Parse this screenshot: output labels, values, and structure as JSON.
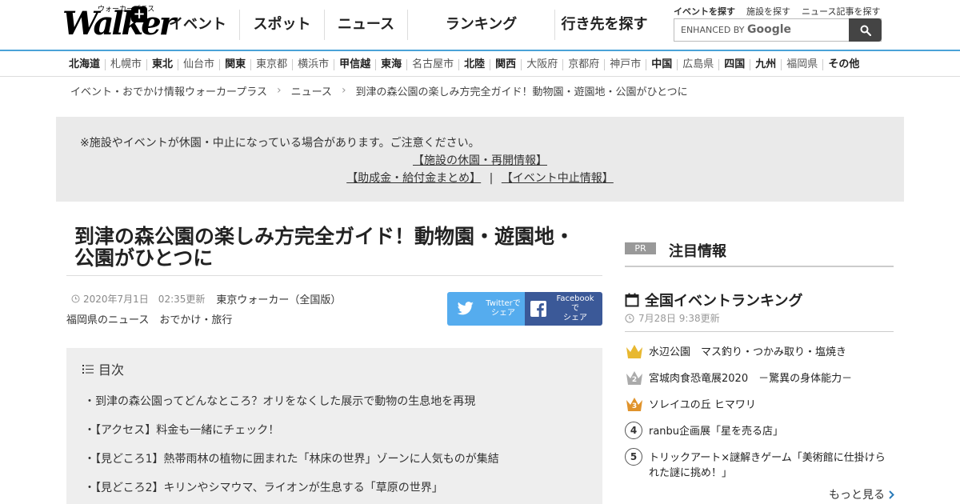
{
  "header": {
    "logo": {
      "name": "Walker",
      "sub": "ウォーカープラス",
      "plus": "+"
    },
    "nav": [
      "イベント",
      "スポット",
      "ニュース",
      "ランキング",
      "行き先を探す"
    ],
    "subnav": [
      "イベントを探す",
      "施設を探す",
      "ニュース記事を探す"
    ],
    "search": {
      "prefix": "ENHANCED BY",
      "brand": "Google"
    }
  },
  "regions": [
    {
      "label": "北海道",
      "major": true
    },
    {
      "label": "札幌市",
      "major": false
    },
    {
      "label": "東北",
      "major": true
    },
    {
      "label": "仙台市",
      "major": false
    },
    {
      "label": "関東",
      "major": true
    },
    {
      "label": "東京都",
      "major": false
    },
    {
      "label": "横浜市",
      "major": false
    },
    {
      "label": "甲信越",
      "major": true
    },
    {
      "label": "東海",
      "major": true
    },
    {
      "label": "名古屋市",
      "major": false
    },
    {
      "label": "北陸",
      "major": true
    },
    {
      "label": "関西",
      "major": true
    },
    {
      "label": "大阪府",
      "major": false
    },
    {
      "label": "京都府",
      "major": false
    },
    {
      "label": "神戸市",
      "major": false
    },
    {
      "label": "中国",
      "major": true
    },
    {
      "label": "広島県",
      "major": false
    },
    {
      "label": "四国",
      "major": true
    },
    {
      "label": "九州",
      "major": true
    },
    {
      "label": "福岡県",
      "major": false
    },
    {
      "label": "その他",
      "major": true
    }
  ],
  "breadcrumb": [
    "イベント・おでかけ情報ウォーカープラス",
    "ニュース",
    "到津の森公園の楽しみ方完全ガイド！動物園・遊園地・公園がひとつに"
  ],
  "notice": {
    "text": "※施設やイベントが休園・中止になっている場合があります。ご注意ください。",
    "link1": "【施設の休園・再開情報】",
    "link2": "【助成金・給付金まとめ】",
    "separator": "|",
    "link3": "【イベント中止情報】"
  },
  "article": {
    "title": "到津の森公園の楽しみ方完全ガイド！動物園・遊園地・公園がひとつに",
    "date": "2020年7月1日　02:35更新",
    "publisher": "東京ウォーカー（全国版）",
    "categories": "福岡県のニュース　おでかけ・旅行",
    "share": {
      "twitter": [
        "Twitterで",
        "シェア"
      ],
      "facebook": [
        "Facebookで",
        "シェア"
      ]
    }
  },
  "toc": {
    "title": "目次",
    "items": [
      "・到津の森公園ってどんなところ？オリをなくした展示で動物の生息地を再現",
      "・【アクセス】料金も一緒にチェック！",
      "・【見どころ1】熱帯雨林の植物に囲まれた「林床の世界」ゾーンに人気ものが集結",
      "・【見どころ2】キリンやシマウマ、ライオンが生息する「草原の世界」"
    ]
  },
  "sidebar": {
    "pr_badge": "PR",
    "pr_title": "注目情報",
    "ranking_title": "全国イベントランキング",
    "ranking_updated": "7月28日 9:38更新",
    "ranking": [
      {
        "rank": "1",
        "title": "水辺公園　マス釣り・つかみ取り・塩焼き",
        "crown_color": "#e8b830"
      },
      {
        "rank": "2",
        "title": "宮城肉食恐竜展2020　－驚異の身体能力－",
        "crown_color": "#aaaaaa"
      },
      {
        "rank": "3",
        "title": "ソレイユの丘 ヒマワリ",
        "crown_color": "#e0932c"
      },
      {
        "rank": "4",
        "title": "ranbu企画展「星を売る店」",
        "crown_color": ""
      },
      {
        "rank": "5",
        "title": "トリックアート×謎解きゲーム「美術館に仕掛けられた謎に挑め！」",
        "crown_color": ""
      }
    ],
    "more": "もっと見る"
  }
}
